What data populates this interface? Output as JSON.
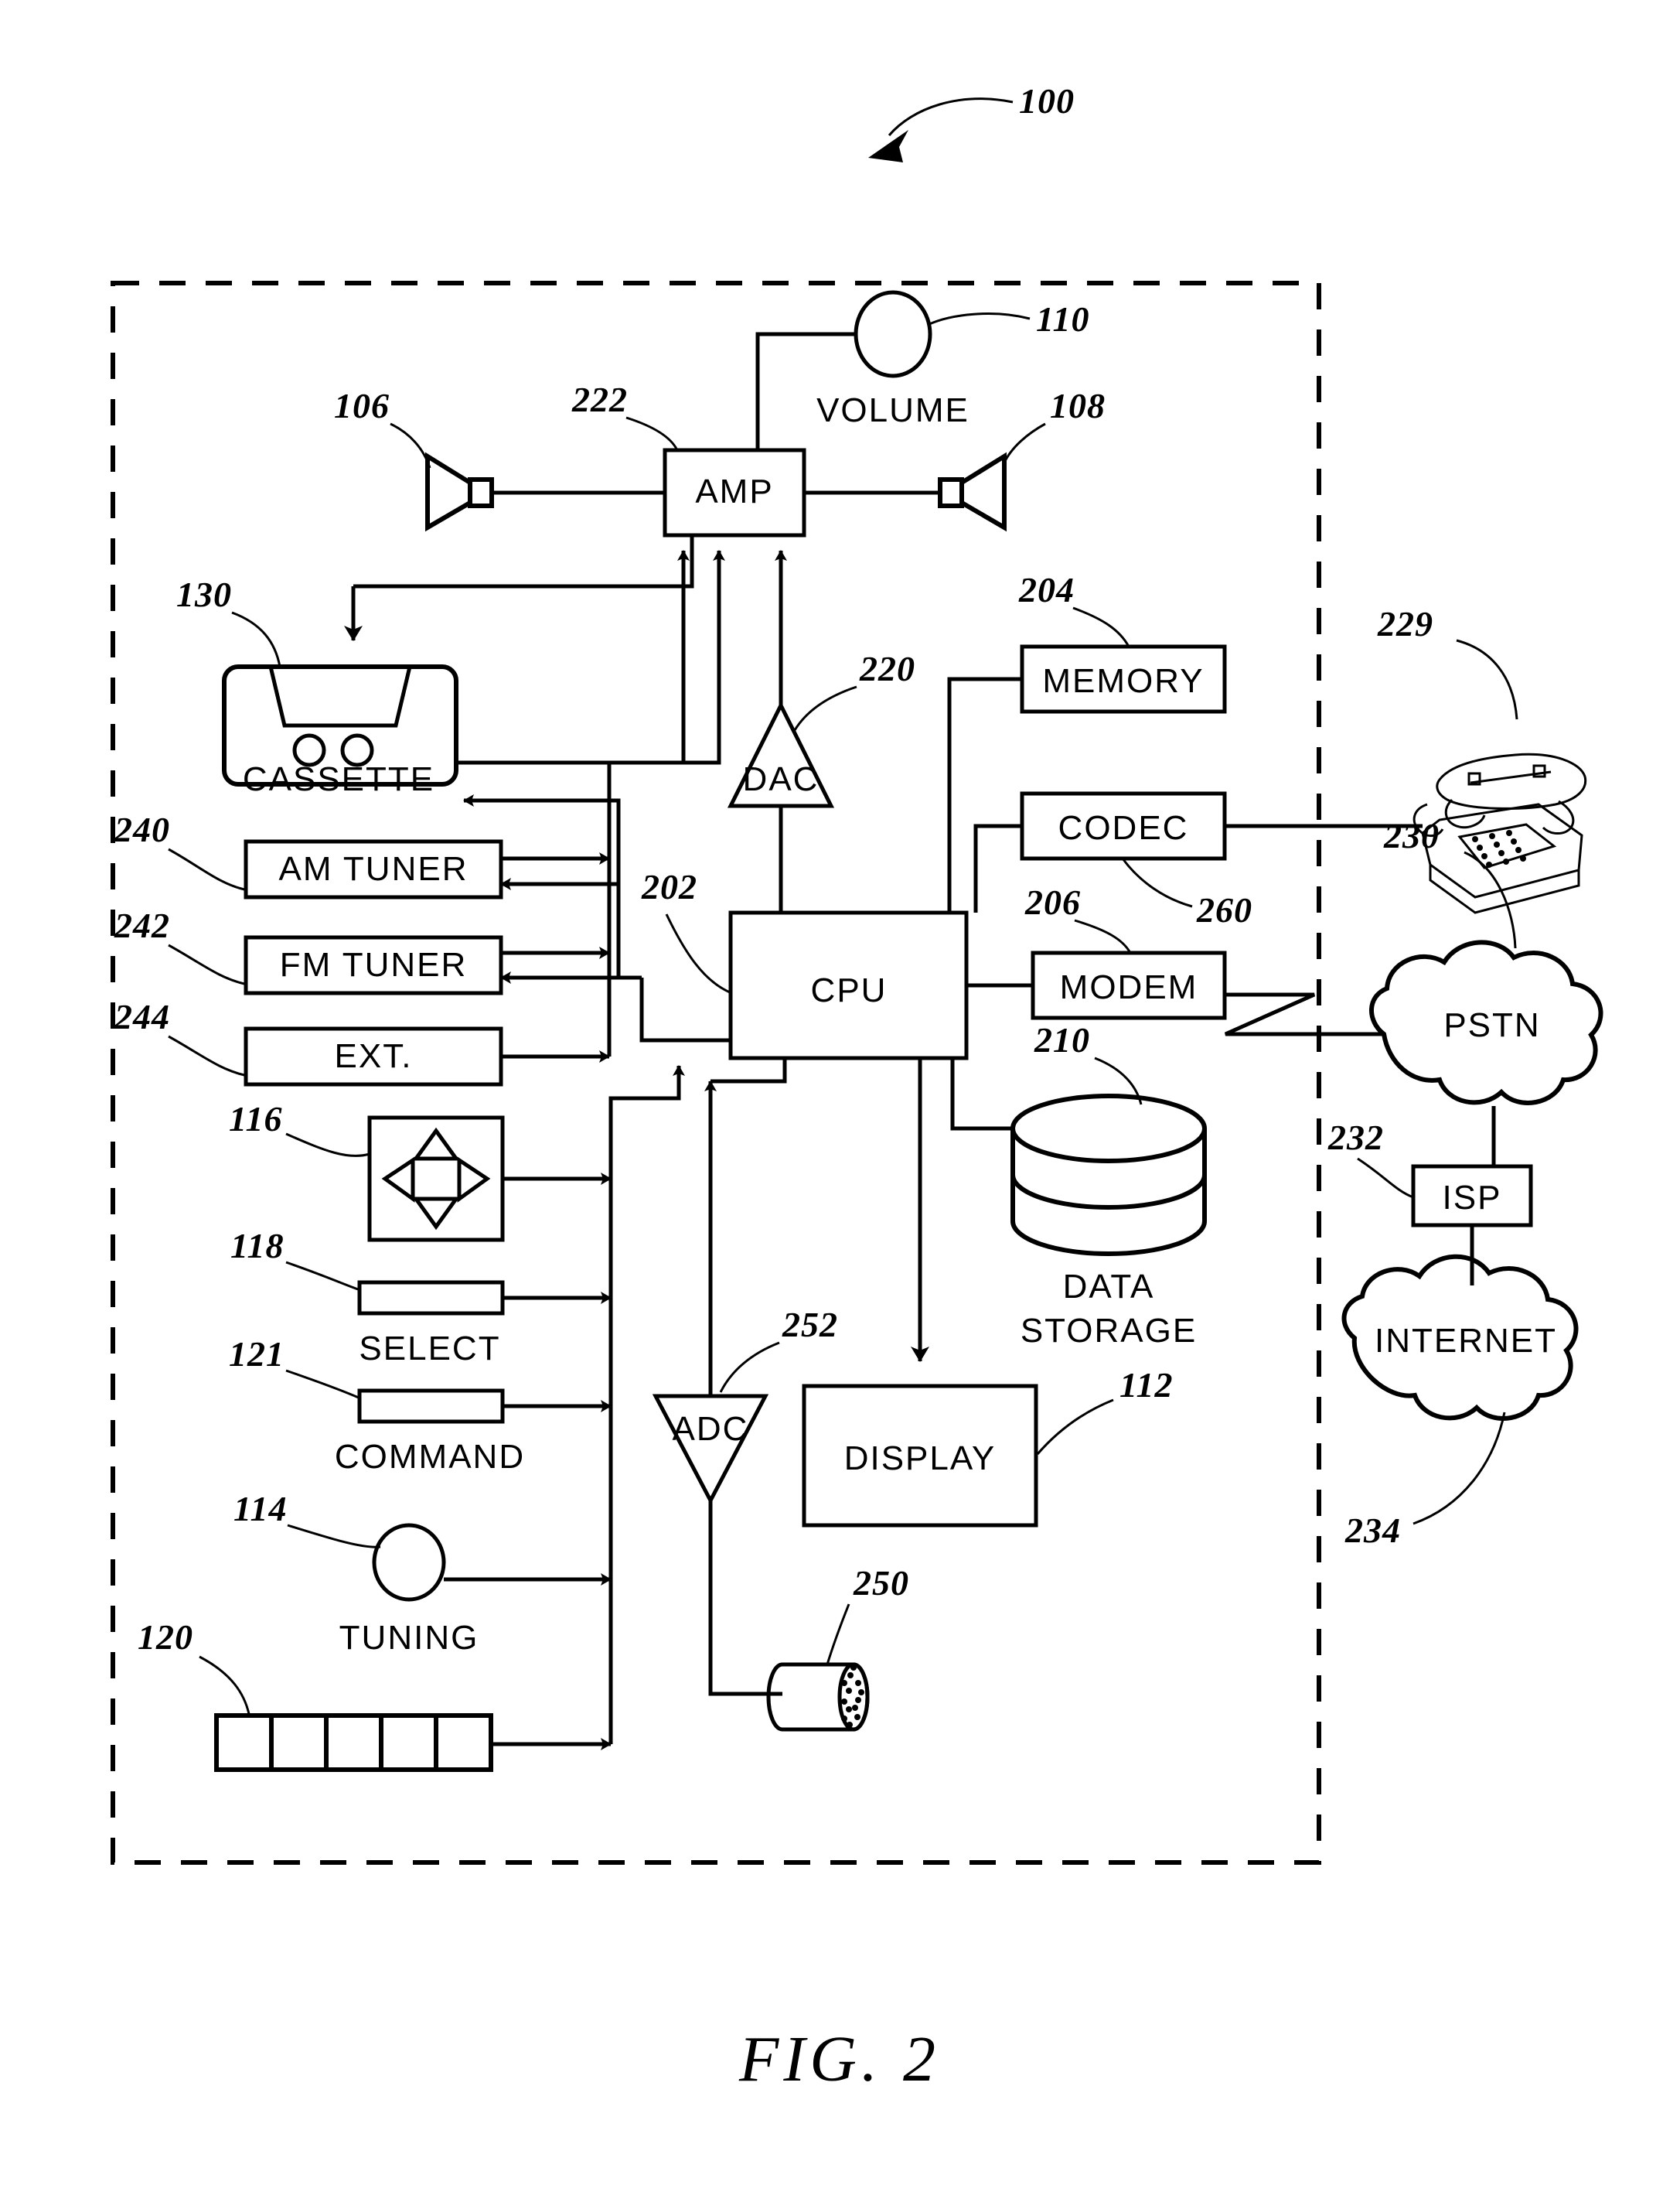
{
  "figure": {
    "caption": "FIG.  2",
    "system_ref": "100",
    "boundary_style": "dashed"
  },
  "blocks": {
    "amp": {
      "label": "AMP",
      "ref": "222"
    },
    "volume": {
      "label": "VOLUME",
      "ref": "110"
    },
    "speaker_left": {
      "label": "",
      "ref": "106"
    },
    "speaker_right": {
      "label": "",
      "ref": "108"
    },
    "cassette": {
      "label": "CASSETTE",
      "ref": "130"
    },
    "am_tuner": {
      "label": "AM  TUNER",
      "ref": "240"
    },
    "fm_tuner": {
      "label": "FM  TUNER",
      "ref": "242"
    },
    "ext": {
      "label": "EXT.",
      "ref": "244"
    },
    "dac": {
      "label": "DAC",
      "ref": "220"
    },
    "adc": {
      "label": "ADC",
      "ref": "252"
    },
    "cpu": {
      "label": "CPU",
      "ref": "202"
    },
    "memory": {
      "label": "MEMORY",
      "ref": "204"
    },
    "codec": {
      "label": "CODEC",
      "ref": "260"
    },
    "modem": {
      "label": "MODEM",
      "ref": "206"
    },
    "data_storage": {
      "label_line1": "DATA",
      "label_line2": "STORAGE",
      "ref": "210"
    },
    "display": {
      "label": "DISPLAY",
      "ref": "112"
    },
    "microphone": {
      "label": "",
      "ref": "250"
    },
    "navpad": {
      "label": "",
      "ref": "116"
    },
    "select": {
      "label": "SELECT",
      "ref": "118"
    },
    "command": {
      "label": "COMMAND",
      "ref": "121"
    },
    "tuning": {
      "label": "TUNING",
      "ref": "114"
    },
    "keypad": {
      "label": "",
      "ref": "120",
      "cells": 5
    },
    "telephone": {
      "label": "",
      "ref": "229"
    },
    "pstn": {
      "label": "PSTN",
      "ref": "230"
    },
    "isp": {
      "label": "ISP",
      "ref": "232"
    },
    "internet": {
      "label": "INTERNET",
      "ref": "234"
    }
  },
  "colors": {
    "ink": "#000000",
    "paper": "#ffffff"
  }
}
